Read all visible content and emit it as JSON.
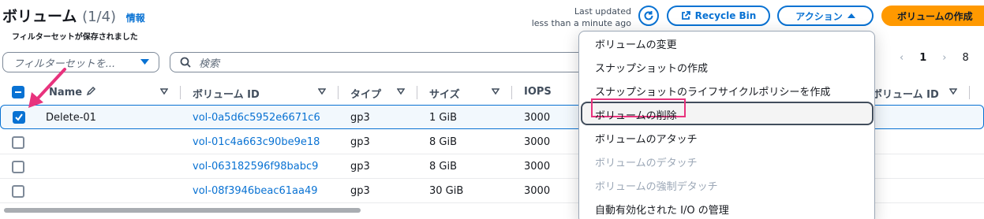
{
  "header": {
    "title": "ボリューム",
    "count": "(1/4)",
    "info_link": "情報",
    "last_updated_line1": "Last updated",
    "last_updated_line2": "less than a minute ago",
    "recycle_bin": "Recycle Bin",
    "actions": "アクション",
    "create": "ボリュームの作成"
  },
  "filters": {
    "saved_filter_label": "フィルターセットが保存されました",
    "saved_filter_placeholder": "フィルターセットを...",
    "search_placeholder": "検索"
  },
  "pagination": {
    "current_page": "1",
    "next_page_partial": "8"
  },
  "table": {
    "columns": {
      "name": "Name",
      "volume_id": "ボリューム ID",
      "type": "タイプ",
      "size": "サイズ",
      "iops": "IOPS",
      "snapshot_volume_id": "ボリューム ID"
    },
    "rows": [
      {
        "name": "Delete-01",
        "volume_id": "vol-0a5d6c5952e6671c6",
        "type": "gp3",
        "size": "1 GiB",
        "iops": "3000",
        "selected": true
      },
      {
        "name": "",
        "volume_id": "vol-01c4a663c90be9e18",
        "type": "gp3",
        "size": "8 GiB",
        "iops": "3000",
        "selected": false
      },
      {
        "name": "",
        "volume_id": "vol-063182596f98babc9",
        "type": "gp3",
        "size": "8 GiB",
        "iops": "3000",
        "selected": false
      },
      {
        "name": "",
        "volume_id": "vol-08f3946beac61aa49",
        "type": "gp3",
        "size": "30 GiB",
        "iops": "3000",
        "selected": false
      }
    ]
  },
  "actions_menu": {
    "items": [
      {
        "label": "ボリュームの変更",
        "disabled": false
      },
      {
        "label": "スナップショットの作成",
        "disabled": false
      },
      {
        "label": "スナップショットのライフサイクルポリシーを作成",
        "disabled": false
      },
      {
        "label": "ボリュームの削除",
        "disabled": false,
        "highlighted": true
      },
      {
        "label": "ボリュームのアタッチ",
        "disabled": false
      },
      {
        "label": "ボリュームのデタッチ",
        "disabled": true
      },
      {
        "label": "ボリュームの強制デタッチ",
        "disabled": true
      },
      {
        "label": "自動有効化された I/O の管理",
        "disabled": false
      }
    ]
  },
  "colors": {
    "link": "#0972d3",
    "primary_button": "#ff9900",
    "annotation": "#e8337d",
    "text": "#16191f",
    "disabled": "#9ba7b6"
  },
  "icons": {
    "refresh": "refresh-icon",
    "external": "external-link-icon",
    "caret_up": "caret-up-icon",
    "search": "search-icon",
    "edit": "pencil-icon",
    "sort": "sort-caret-icon"
  }
}
